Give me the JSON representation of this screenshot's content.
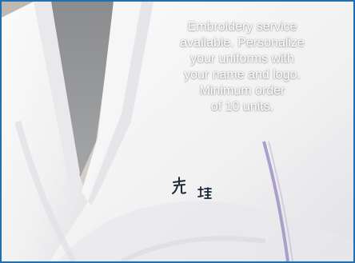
{
  "caption": {
    "lines": [
      "Embroidery service",
      "available.  Personalize",
      "your uniforms with",
      "your name and logo.",
      "Minimum order",
      "of 10 units."
    ]
  },
  "colors": {
    "border": "#1f6fb4",
    "caption_text": "#ffffff",
    "embroidery_thread": "#1c2a3a"
  },
  "icons": {
    "embroidered_name": "kanji-embroidery"
  }
}
